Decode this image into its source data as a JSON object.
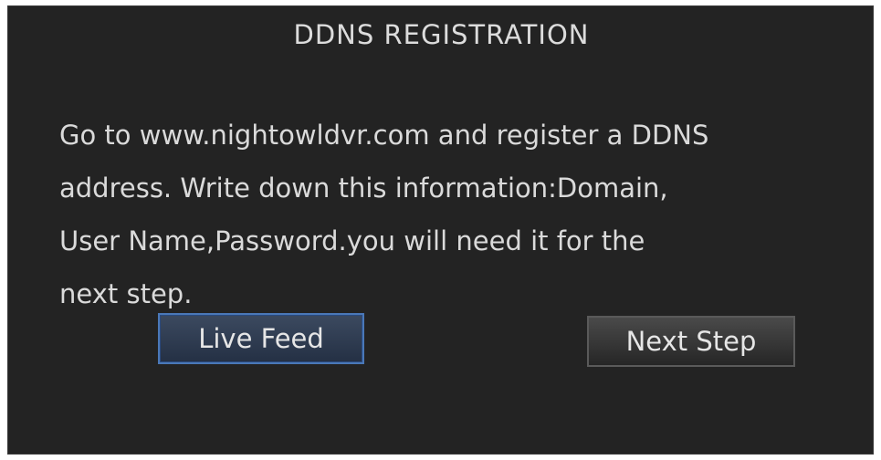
{
  "dialog": {
    "title": "DDNS REGISTRATION",
    "message_lines": [
      "Go to www.nightowldvr.com and register a DDNS",
      "address. Write down this information:Domain,",
      "User Name,Password.you will need it for the",
      "next step."
    ],
    "buttons": {
      "live_feed": "Live Feed",
      "next_step": "Next Step"
    }
  },
  "colors": {
    "background": "#232323",
    "text": "#dadada",
    "focus_border": "#4a78b8"
  }
}
